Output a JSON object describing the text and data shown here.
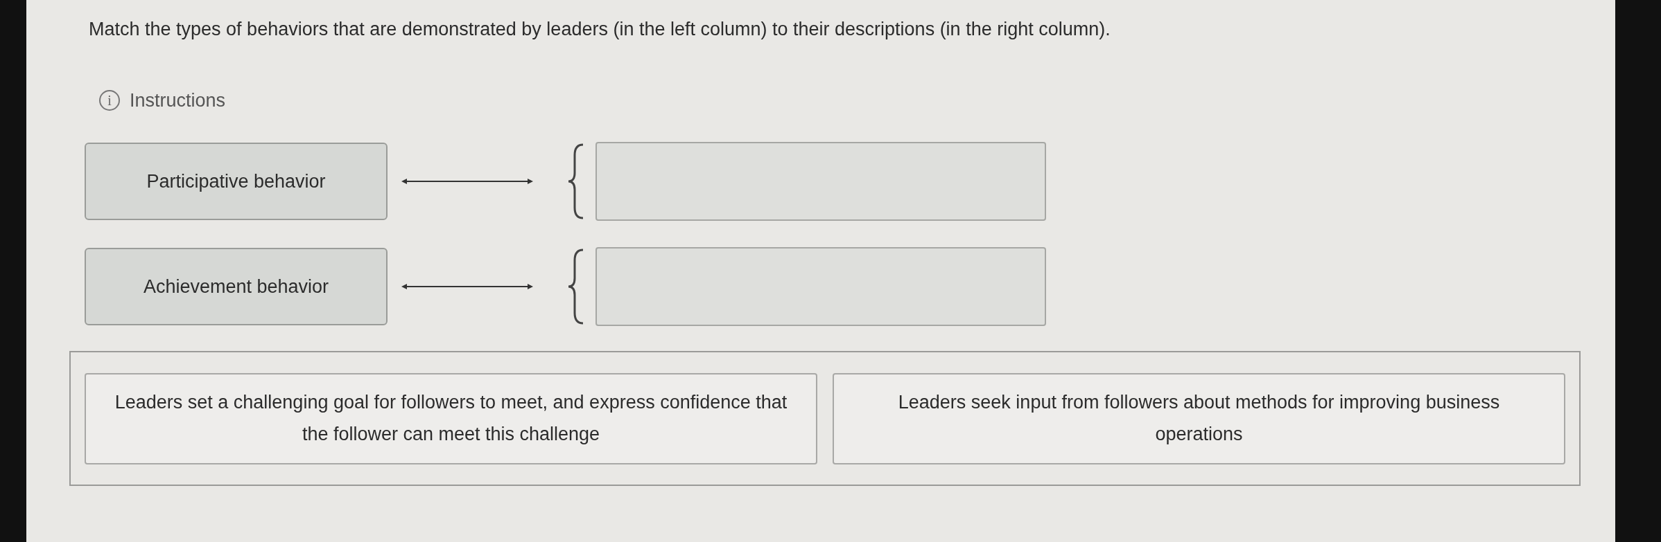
{
  "question": "Match the types of behaviors that are demonstrated by leaders (in the left column) to their descriptions (in the right column).",
  "instructions": {
    "icon": "i",
    "label": "Instructions"
  },
  "pairs": [
    {
      "term": "Participative behavior"
    },
    {
      "term": "Achievement behavior"
    }
  ],
  "choices": [
    "Leaders set a challenging goal for followers to meet, and express confidence that the follower can meet this challenge",
    "Leaders seek input from followers about methods for improving business operations"
  ]
}
